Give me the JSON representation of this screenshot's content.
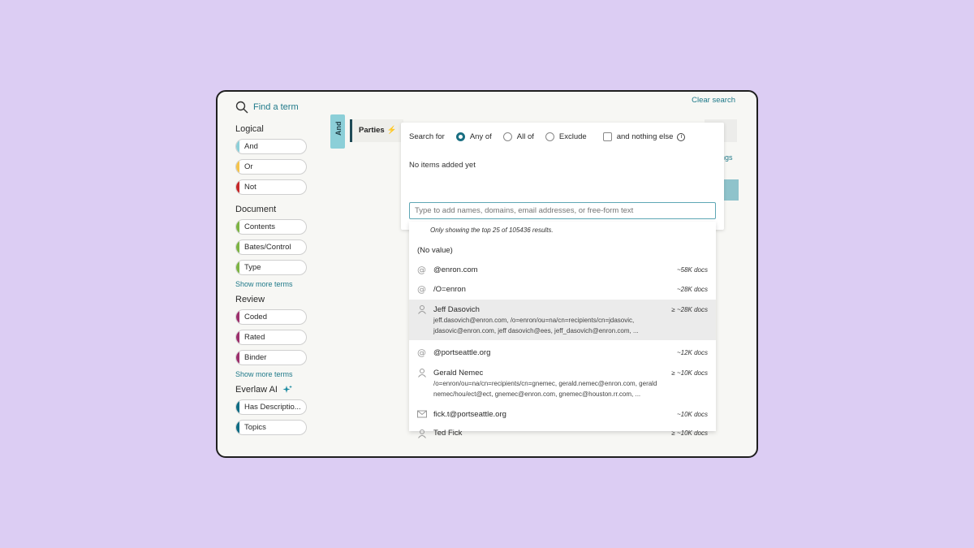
{
  "search": {
    "find_label": "Find a term",
    "clear_label": "Clear search"
  },
  "sidebar": {
    "sections": [
      {
        "title": "Logical",
        "items": [
          {
            "label": "And",
            "color": "#8ccfd8"
          },
          {
            "label": "Or",
            "color": "#f4c34a"
          },
          {
            "label": "Not",
            "color": "#c62828"
          }
        ]
      },
      {
        "title": "Document",
        "items": [
          {
            "label": "Contents",
            "color": "#7cb342"
          },
          {
            "label": "Bates/Control",
            "color": "#7cb342"
          },
          {
            "label": "Type",
            "color": "#7cb342"
          }
        ],
        "show_more": "Show more terms"
      },
      {
        "title": "Review",
        "items": [
          {
            "label": "Coded",
            "color": "#9c2f6c"
          },
          {
            "label": "Rated",
            "color": "#9c2f6c"
          },
          {
            "label": "Binder",
            "color": "#9c2f6c"
          }
        ],
        "show_more": "Show more terms"
      },
      {
        "title": "Everlaw AI",
        "items": [
          {
            "label": "Has Descriptio...",
            "color": "#0f6c83"
          },
          {
            "label": "Topics",
            "color": "#0f6c83"
          }
        ]
      }
    ]
  },
  "query": {
    "and_label": "And",
    "parties_label": "Parties",
    "partial_link": "ngs"
  },
  "panel": {
    "search_for": "Search for",
    "options": [
      "Any of",
      "All of",
      "Exclude"
    ],
    "selected": "Any of",
    "nothing_else": "and nothing else",
    "info_glyph": "i",
    "empty_text": "No items added yet",
    "input_placeholder": "Type to add names, domains, email addresses, or free-form text"
  },
  "results": {
    "notice": "Only showing the top 25 of 105436 results.",
    "items": [
      {
        "icon": "none",
        "name": "(No value)",
        "docs": "",
        "sub": ""
      },
      {
        "icon": "at-icon",
        "name": "@enron.com",
        "docs": "~58K docs",
        "sub": ""
      },
      {
        "icon": "at-icon",
        "name": "/O=enron",
        "docs": "~28K docs",
        "sub": ""
      },
      {
        "icon": "person-icon",
        "name": "Jeff Dasovich",
        "docs": "≥ ~28K docs",
        "sub": "jeff.dasovich@enron.com, /o=enron/ou=na/cn=recipients/cn=jdasovic, jdasovic@enron.com, jeff dasovich@ees, jeff_dasovich@enron.com, ...",
        "highlighted": true
      },
      {
        "icon": "at-icon",
        "name": "@portseattle.org",
        "docs": "~12K docs",
        "sub": ""
      },
      {
        "icon": "person-icon",
        "name": "Gerald Nemec",
        "docs": "≥ ~10K docs",
        "sub": "/o=enron/ou=na/cn=recipients/cn=gnemec, gerald.nemec@enron.com, gerald nemec/hou/ect@ect, gnemec@enron.com, gnemec@houston.rr.com, ..."
      },
      {
        "icon": "mail-icon",
        "name": "fick.t@portseattle.org",
        "docs": "~10K docs",
        "sub": ""
      },
      {
        "icon": "person-icon",
        "name": "Ted Fick",
        "docs": "≥ ~10K docs",
        "sub": ""
      }
    ]
  },
  "colors": {
    "accent": "#207a8a",
    "background": "#dccdf3"
  }
}
